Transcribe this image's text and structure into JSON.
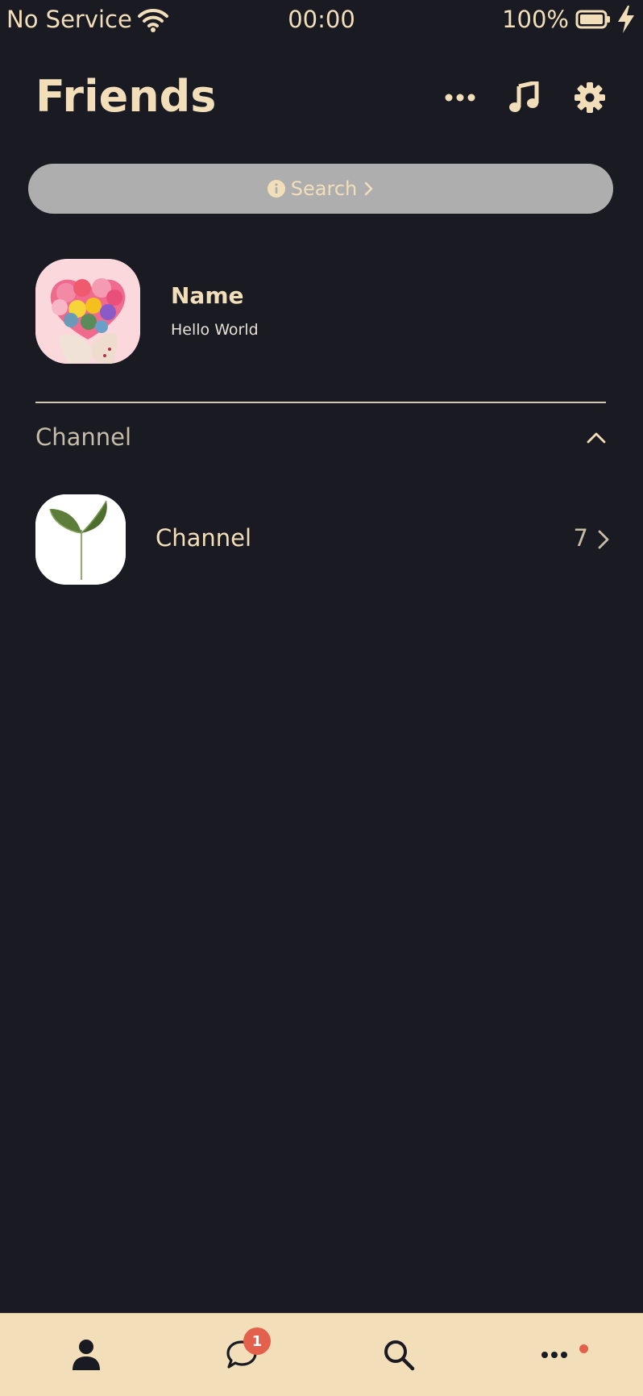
{
  "status_bar": {
    "carrier": "No Service",
    "time": "00:00",
    "battery": "100%"
  },
  "header": {
    "title": "Friends",
    "icons": [
      "more-icon",
      "music-icon",
      "gear-icon"
    ]
  },
  "search": {
    "label": "Search"
  },
  "profile": {
    "name": "Name",
    "status": "Hello World"
  },
  "section": {
    "title": "Channel"
  },
  "channel": {
    "name": "Channel",
    "count": "7"
  },
  "tab_bar": {
    "icons": [
      "person-icon",
      "chat-icon",
      "search-icon",
      "more-icon"
    ],
    "chat_badge": "1"
  },
  "colors": {
    "background": "#191a22",
    "accent": "#f2dfba",
    "search_bg": "#aeaeae",
    "badge": "#e2604c"
  }
}
